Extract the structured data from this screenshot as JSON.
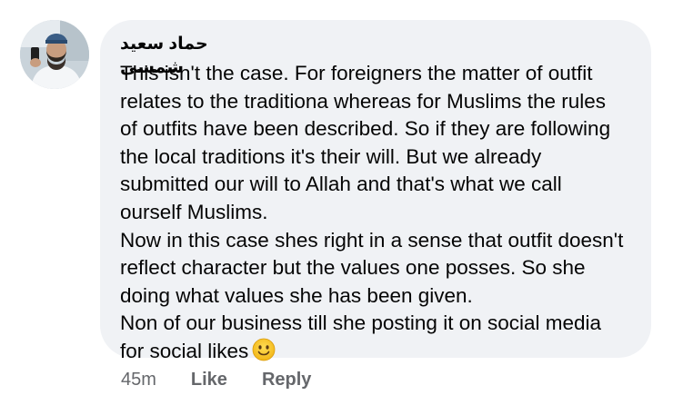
{
  "comment": {
    "author": "حماد سعید شمسی",
    "lines": [
      "This isn't the case. For foreigners the matter of outfit",
      "relates to the traditiona whereas for Muslims the rules",
      "of outfits have been described. So if they are following",
      "the local traditions it's their will. But we already",
      "submitted our will to Allah and that's what we call",
      "ourself Muslims.",
      "Now in this case shes right in a sense that outfit doesn't",
      "reflect character but the values one posses. So she",
      "doing what values she has been given.",
      "Non of our business till she posting it on social media",
      "for social likes"
    ],
    "emoji": "slightly-smiling-face-icon",
    "timestamp": "45m",
    "like_label": "Like",
    "reply_label": "Reply"
  },
  "colors": {
    "bubble": "#f0f2f5",
    "text": "#050505",
    "muted": "#65676b",
    "emoji": "#f7c625"
  }
}
